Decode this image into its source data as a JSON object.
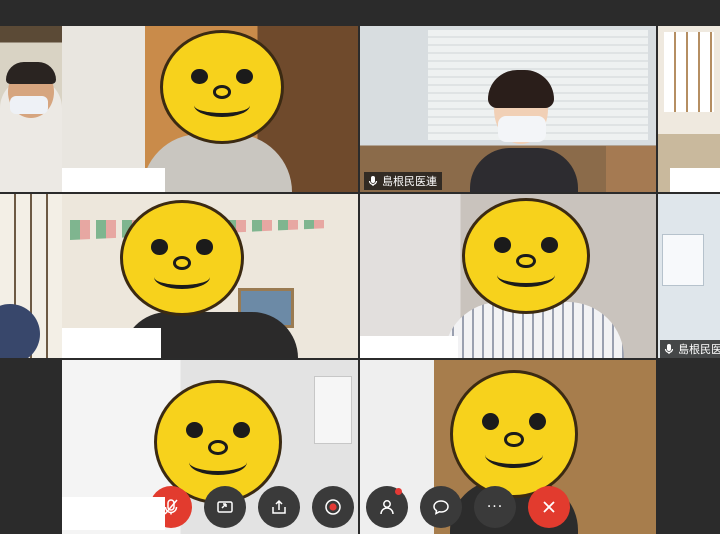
{
  "participants": [
    {
      "id": "p1",
      "name": ""
    },
    {
      "id": "p2",
      "name": ""
    },
    {
      "id": "p3",
      "name": "島根民医連"
    },
    {
      "id": "p4",
      "name": ""
    },
    {
      "id": "p5",
      "name": ""
    },
    {
      "id": "p6",
      "name": ""
    },
    {
      "id": "p7",
      "name": "島根民医"
    },
    {
      "id": "p8",
      "name": ""
    },
    {
      "id": "p9",
      "name": ""
    }
  ],
  "active_speaker": "p3",
  "toolbar": {
    "buttons": [
      "microphone",
      "screen-share",
      "share",
      "record",
      "participants",
      "chat",
      "more",
      "leave"
    ],
    "more_label": "···",
    "participants_badge": true
  },
  "colors": {
    "accent_border": "#29a8e0",
    "toolbar_bg": "#3a3a3a",
    "leave_red": "#e23b2e",
    "mask_yellow": "#f7d21c"
  }
}
